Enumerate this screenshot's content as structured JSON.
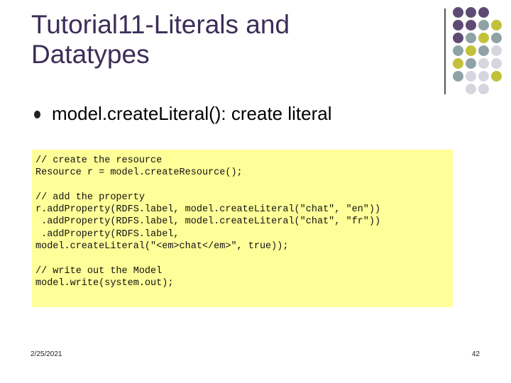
{
  "slide": {
    "title_line1": "Tutorial11-Literals and",
    "title_line2": "Datatypes",
    "bullet": "model.createLiteral(): create literal",
    "code_lines": [
      "// create the resource",
      "Resource r = model.createResource();",
      "",
      "// add the property",
      "r.addProperty(RDFS.label, model.createLiteral(\"chat\", \"en\"))",
      " .addProperty(RDFS.label, model.createLiteral(\"chat\", \"fr\"))",
      " .addProperty(RDFS.label,",
      "model.createLiteral(\"<em>chat</em>\", true));",
      "",
      "// write out the Model",
      "model.write(system.out);"
    ],
    "footer_date": "2/25/2021",
    "footer_page": "42"
  },
  "colors": {
    "title": "#3b2e58",
    "code_background": "#ffff99",
    "dot_purple": "#5e4b73",
    "dot_teal": "#8fa3a6",
    "dot_olive": "#c2c13a",
    "dot_light": "#d6d6df"
  },
  "decoration": {
    "dot_grid": [
      [
        "purple",
        "purple",
        "purple",
        "none"
      ],
      [
        "purple",
        "purple",
        "teal",
        "olive"
      ],
      [
        "purple",
        "teal",
        "olive",
        "teal"
      ],
      [
        "teal",
        "olive",
        "teal",
        "light"
      ],
      [
        "olive",
        "teal",
        "light",
        "light"
      ],
      [
        "teal",
        "light",
        "light",
        "olive"
      ],
      [
        "none",
        "light",
        "light",
        "none"
      ]
    ]
  }
}
